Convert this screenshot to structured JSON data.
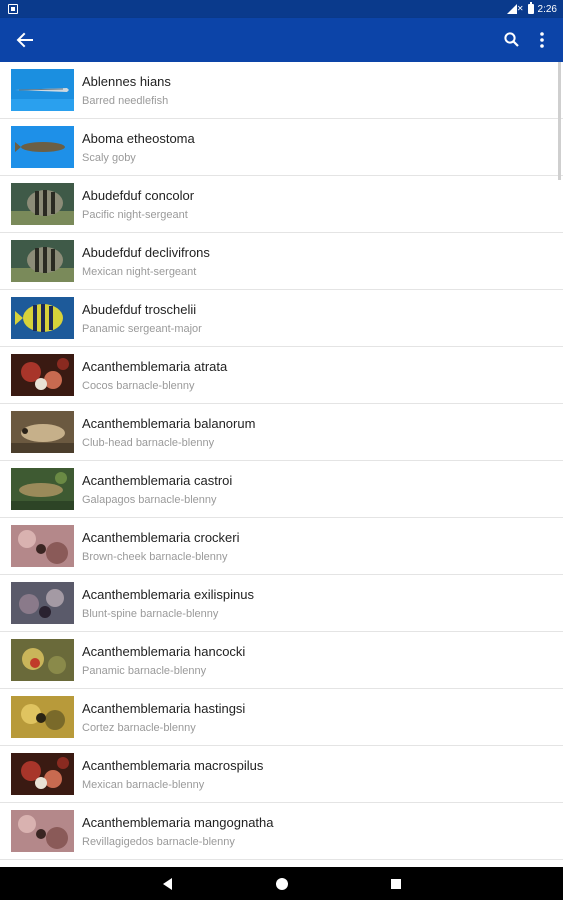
{
  "status_bar": {
    "time": "2:26"
  },
  "app_bar": {
    "color": "#0c44a8",
    "icons": [
      "back-arrow-icon",
      "search-icon",
      "more-vert-icon"
    ]
  },
  "species": [
    {
      "scientific": "Ablennes hians",
      "common": "Barred needlefish",
      "thumb": "needlefish"
    },
    {
      "scientific": "Aboma etheostoma",
      "common": "Scaly goby",
      "thumb": "goby"
    },
    {
      "scientific": "Abudefduf concolor",
      "common": "Pacific night-sergeant",
      "thumb": "sergeant"
    },
    {
      "scientific": "Abudefduf declivifrons",
      "common": "Mexican night-sergeant",
      "thumb": "sergeant"
    },
    {
      "scientific": "Abudefduf troschelii",
      "common": "Panamic sergeant-major",
      "thumb": "sergeant-major"
    },
    {
      "scientific": "Acanthemblemaria atrata",
      "common": "Cocos barnacle-blenny",
      "thumb": "blenny-red"
    },
    {
      "scientific": "Acanthemblemaria balanorum",
      "common": "Club-head barnacle-blenny",
      "thumb": "blenny-sand"
    },
    {
      "scientific": "Acanthemblemaria castroi",
      "common": "Galapagos barnacle-blenny",
      "thumb": "blenny-green"
    },
    {
      "scientific": "Acanthemblemaria crockeri",
      "common": "Brown-cheek barnacle-blenny",
      "thumb": "blenny-pink"
    },
    {
      "scientific": "Acanthemblemaria exilispinus",
      "common": "Blunt-spine barnacle-blenny",
      "thumb": "blenny-rock"
    },
    {
      "scientific": "Acanthemblemaria hancocki",
      "common": "Panamic barnacle-blenny",
      "thumb": "blenny-yellow"
    },
    {
      "scientific": "Acanthemblemaria hastingsi",
      "common": "Cortez barnacle-blenny",
      "thumb": "blenny-gold"
    },
    {
      "scientific": "Acanthemblemaria macrospilus",
      "common": "Mexican barnacle-blenny",
      "thumb": "blenny-red"
    },
    {
      "scientific": "Acanthemblemaria mangognatha",
      "common": "Revillagigedos barnacle-blenny",
      "thumb": "blenny-pink"
    }
  ]
}
